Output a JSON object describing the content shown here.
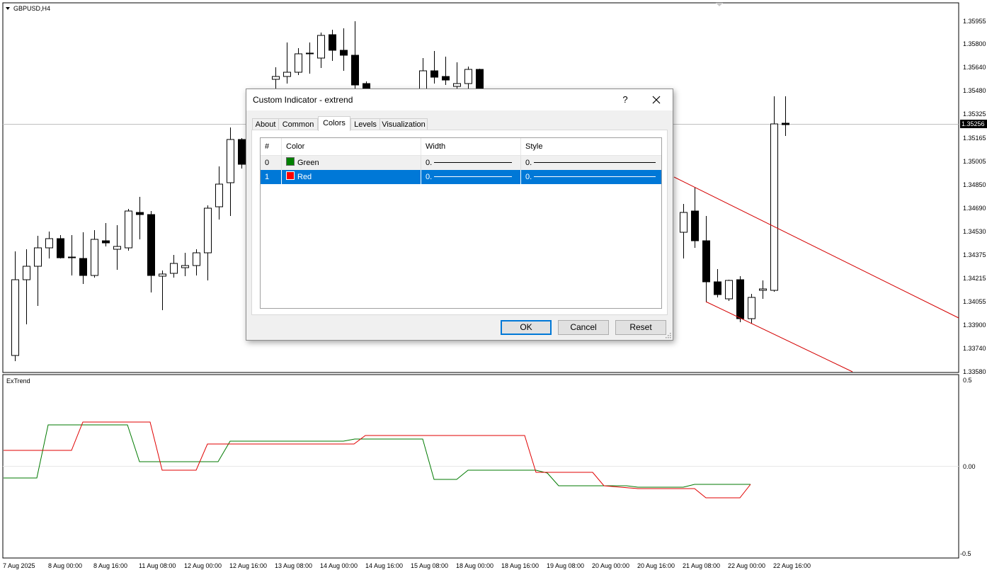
{
  "chart": {
    "symbol_label": "GBPUSD,H4",
    "indicator_label": "ExTrend",
    "current_price": "1.35256",
    "price_ticks": [
      "1.35955",
      "1.35800",
      "1.35640",
      "1.35480",
      "1.35325",
      "1.35165",
      "1.35005",
      "1.34850",
      "1.34690",
      "1.34530",
      "1.34375",
      "1.34215",
      "1.34055",
      "1.33900",
      "1.33740",
      "1.33580"
    ],
    "indicator_ticks": [
      "0.5",
      "0.00",
      "-0.5"
    ],
    "time_labels": [
      "7 Aug 2025",
      "8 Aug 00:00",
      "8 Aug 16:00",
      "11 Aug 08:00",
      "12 Aug 00:00",
      "12 Aug 16:00",
      "13 Aug 08:00",
      "14 Aug 00:00",
      "14 Aug 16:00",
      "15 Aug 08:00",
      "18 Aug 00:00",
      "18 Aug 16:00",
      "19 Aug 08:00",
      "20 Aug 00:00",
      "20 Aug 16:00",
      "21 Aug 08:00",
      "22 Aug 00:00",
      "22 Aug 16:00"
    ],
    "colors": {
      "bull_candle": "#ffffff",
      "bear_candle": "#000000",
      "trend_line": "#d40000",
      "green_line": "#007a00",
      "red_line": "#e00000"
    }
  },
  "dialog": {
    "title": "Custom Indicator - extrend",
    "help_label": "?",
    "tabs": [
      "About",
      "Common",
      "Colors",
      "Levels",
      "Visualization"
    ],
    "active_tab": "Colors",
    "columns": [
      "#",
      "Color",
      "Width",
      "Style"
    ],
    "rows": [
      {
        "index": "0",
        "color_name": "Green",
        "swatch": "#008000",
        "width": "0.",
        "style": "0."
      },
      {
        "index": "1",
        "color_name": "Red",
        "swatch": "#ff0000",
        "width": "0.",
        "style": "0."
      }
    ],
    "selected_row": 1,
    "buttons": {
      "ok": "OK",
      "cancel": "Cancel",
      "reset": "Reset"
    }
  }
}
